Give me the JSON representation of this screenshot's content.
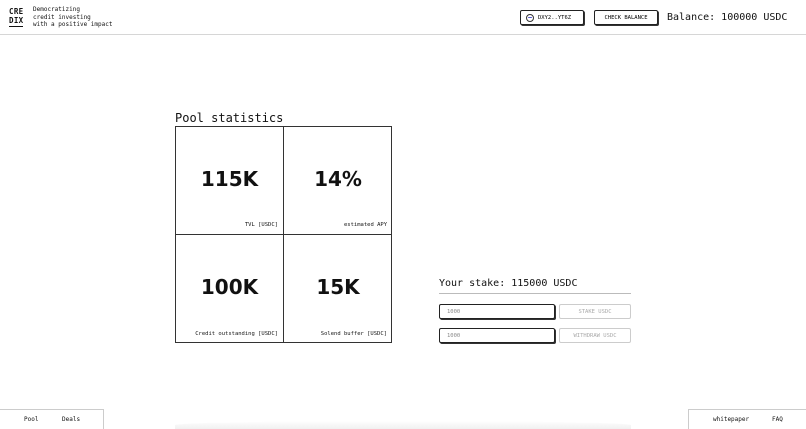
{
  "header": {
    "logo_line1": "CRE",
    "logo_line2": "DIX",
    "tagline": [
      "Democratizing",
      "credit investing",
      "with a positive impact"
    ],
    "wallet_label": "DXY2..YT6Z",
    "check_balance_label": "CHECK BALANCE",
    "balance_text": "Balance: 100000 USDC"
  },
  "pool": {
    "title": "Pool statistics",
    "stats": [
      {
        "value": "115K",
        "label": "TVL [USDC]"
      },
      {
        "value": "14%",
        "label": "estimated APY"
      },
      {
        "value": "100K",
        "label": "Credit outstanding [USDC]"
      },
      {
        "value": "15K",
        "label": "Solend buffer [USDC]"
      }
    ]
  },
  "stake": {
    "title": "Your stake: 115000 USDC",
    "stake_placeholder": "1000",
    "stake_button": "STAKE USDC",
    "withdraw_placeholder": "1000",
    "withdraw_button": "WITHDRAW USDC"
  },
  "footer": {
    "left_links": [
      "Pool",
      "Deals"
    ],
    "right_links": [
      "whitepaper",
      "FAQ"
    ]
  },
  "icons": {
    "wallet": "wallet-icon"
  }
}
